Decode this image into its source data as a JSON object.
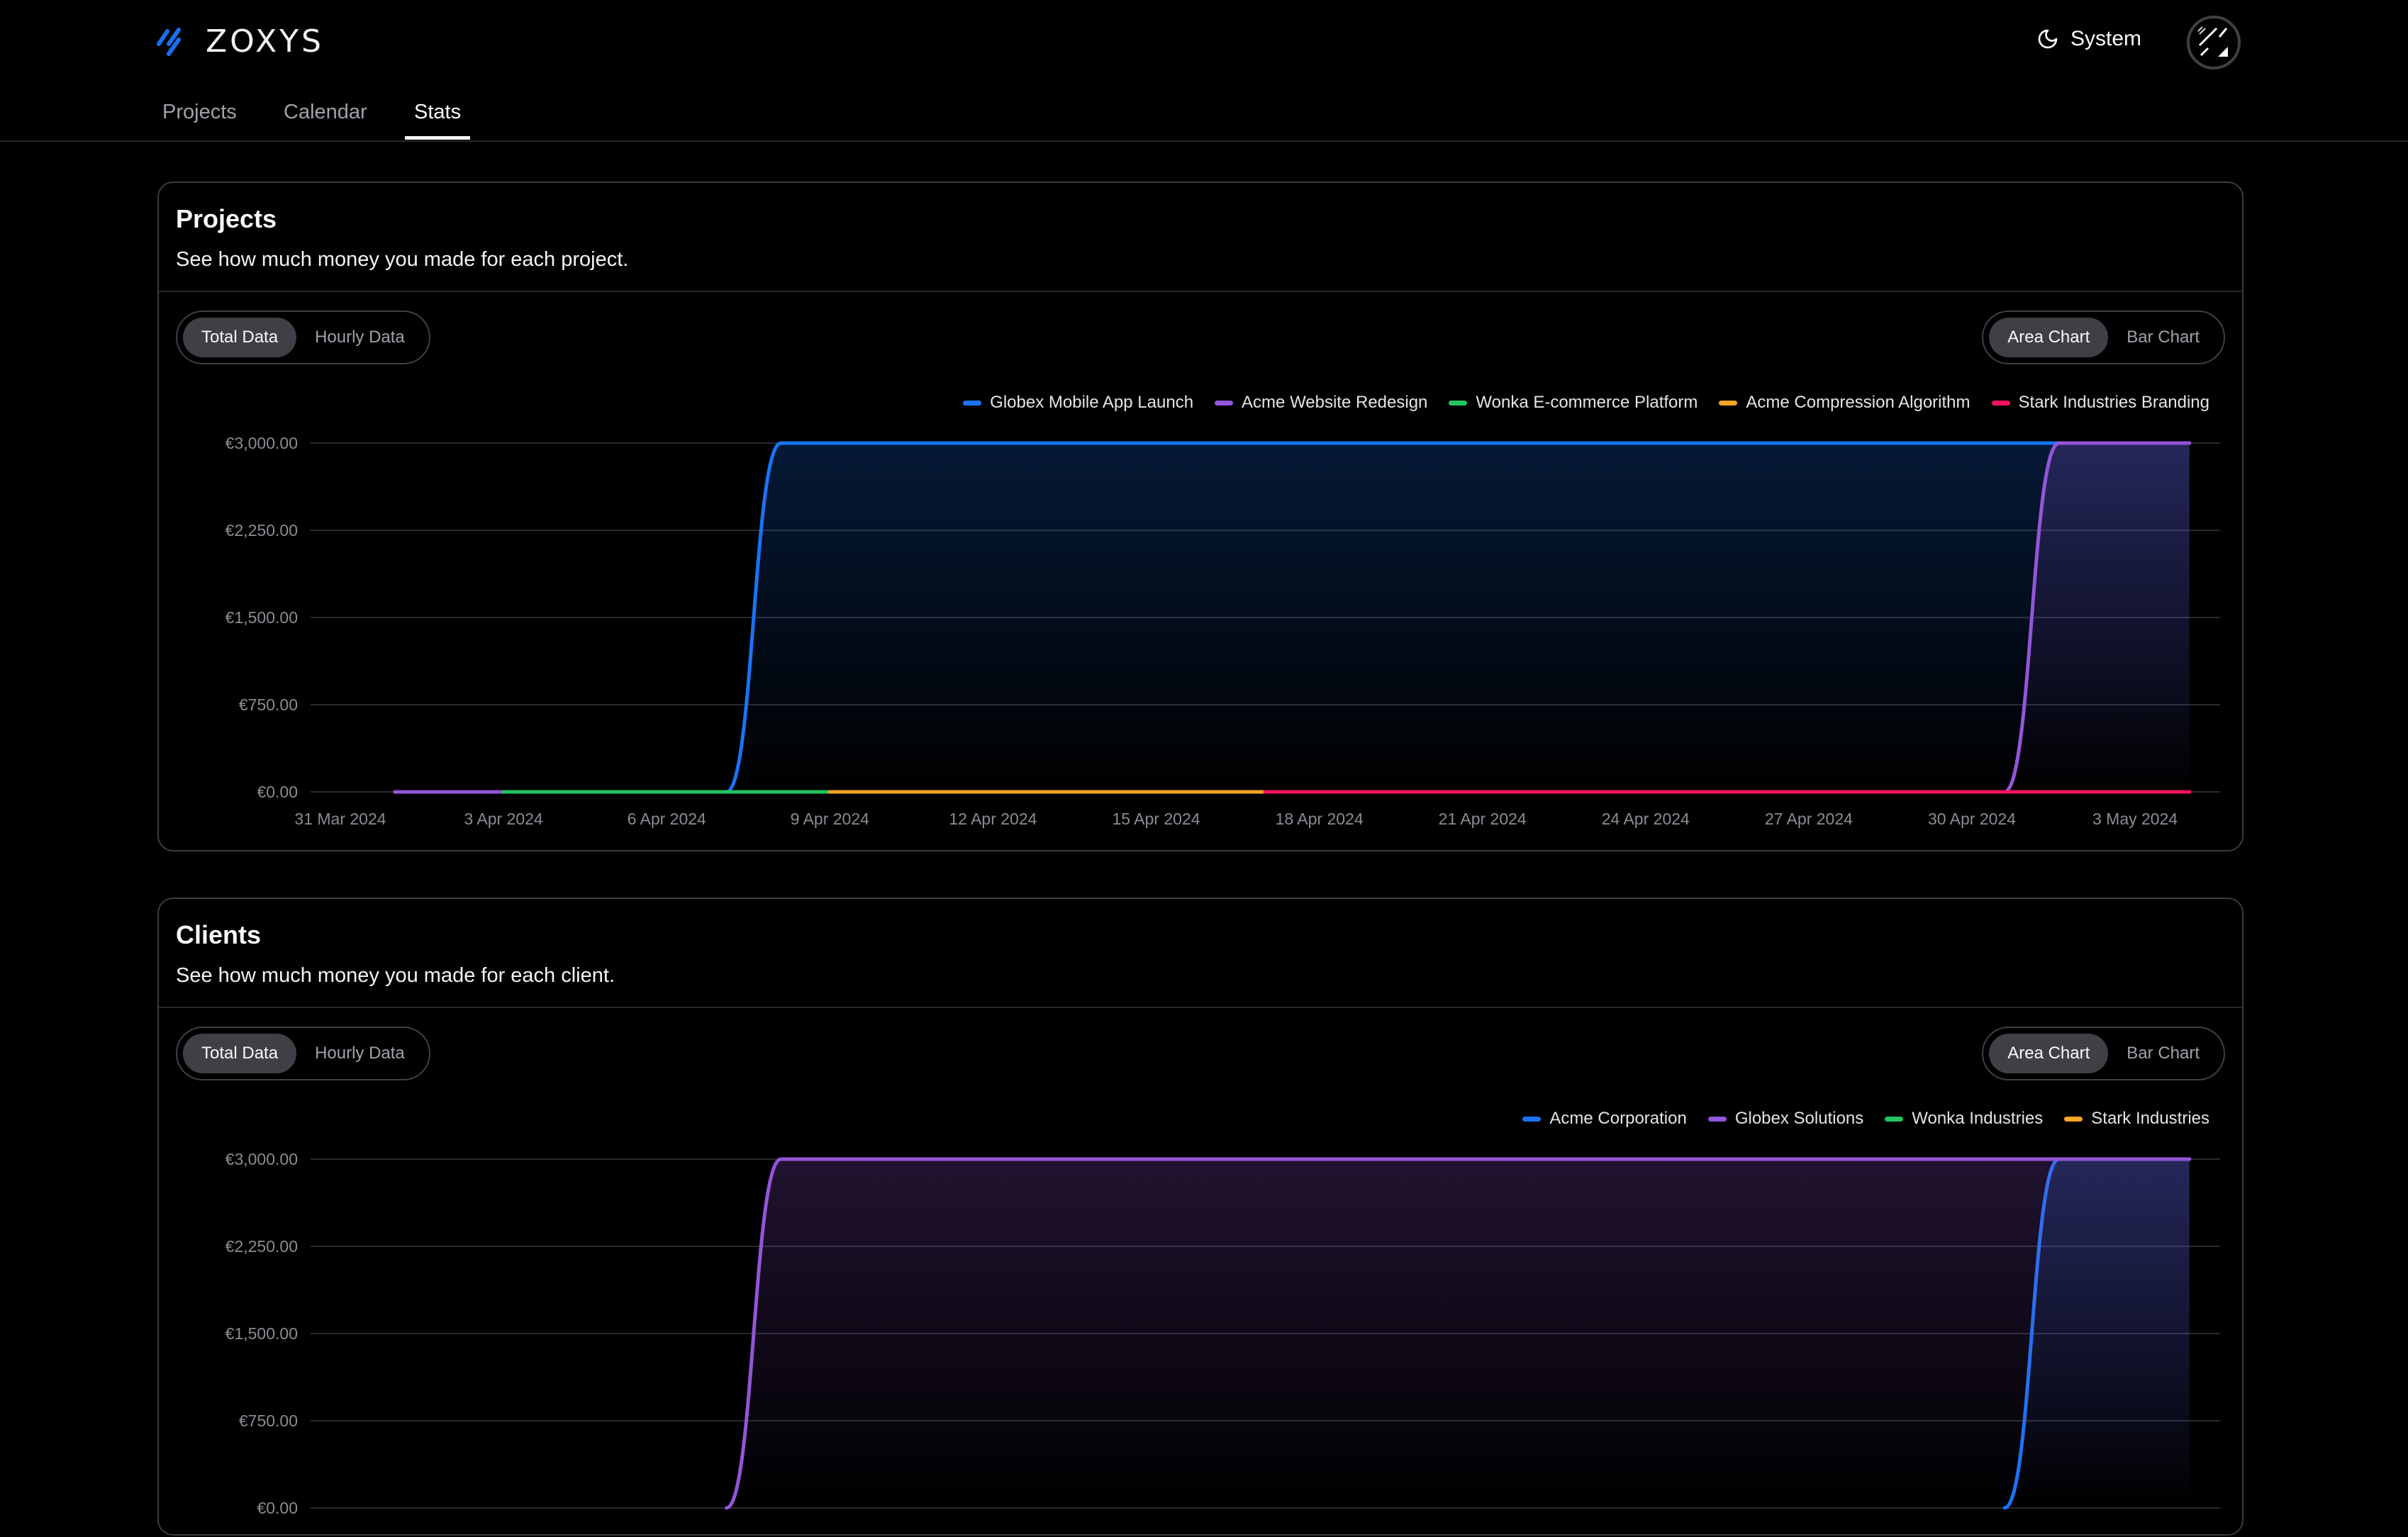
{
  "app": {
    "brand": "ZOXYS",
    "logo_icon": "triple-slash-logo-icon"
  },
  "nav": {
    "tabs": [
      {
        "label": "Projects",
        "active": false
      },
      {
        "label": "Calendar",
        "active": false
      },
      {
        "label": "Stats",
        "active": true
      }
    ]
  },
  "header": {
    "theme_label": "System",
    "theme_icon": "moon-icon",
    "avatar_icon": "avatar-pattern-icon"
  },
  "colors": {
    "blue": "#1a73f5",
    "purple": "#9355d9",
    "green": "#22c55e",
    "orange": "#f5a524",
    "red": "#f31260",
    "grid": "#2a2a2e",
    "tick": "#8b8b94"
  },
  "cards": [
    {
      "title": "Projects",
      "subtitle": "See how much money you made for each project.",
      "data_toggle": [
        {
          "label": "Total Data",
          "active": true
        },
        {
          "label": "Hourly Data",
          "active": false
        }
      ],
      "chart_toggle": [
        {
          "label": "Area Chart",
          "active": true
        },
        {
          "label": "Bar Chart",
          "active": false
        }
      ]
    },
    {
      "title": "Clients",
      "subtitle": "See how much money you made for each client.",
      "data_toggle": [
        {
          "label": "Total Data",
          "active": true
        },
        {
          "label": "Hourly Data",
          "active": false
        }
      ],
      "chart_toggle": [
        {
          "label": "Area Chart",
          "active": true
        },
        {
          "label": "Bar Chart",
          "active": false
        }
      ]
    }
  ],
  "chart_data": [
    {
      "type": "area",
      "title": "Projects",
      "xlabel": "",
      "ylabel": "",
      "x_ticks": [
        "31 Mar 2024",
        "3 Apr 2024",
        "6 Apr 2024",
        "9 Apr 2024",
        "12 Apr 2024",
        "15 Apr 2024",
        "18 Apr 2024",
        "21 Apr 2024",
        "24 Apr 2024",
        "27 Apr 2024",
        "30 Apr 2024",
        "3 May 2024"
      ],
      "y_ticks": [
        "€0.00",
        "€750.00",
        "€1,500.00",
        "€2,250.00",
        "€3,000.00"
      ],
      "ylim": [
        0,
        3000
      ],
      "xlim_days": [
        0,
        34
      ],
      "x_origin": "31 Mar 2024",
      "grid": true,
      "legend_position": "top-right",
      "series": [
        {
          "name": "Globex Mobile App Launch",
          "color": "#1a73f5",
          "points": [
            [
              7.1,
              0
            ],
            [
              8.1,
              3000
            ],
            [
              34.0,
              3000
            ]
          ]
        },
        {
          "name": "Acme Website Redesign",
          "color": "#9355d9",
          "points": [
            [
              1.0,
              0
            ],
            [
              3.0,
              0
            ]
          ],
          "points2": [
            [
              30.6,
              0
            ],
            [
              31.6,
              3000
            ],
            [
              34.0,
              3000
            ]
          ]
        },
        {
          "name": "Wonka E-commerce Platform",
          "color": "#22c55e",
          "points": [
            [
              3.0,
              0
            ],
            [
              9.0,
              0
            ]
          ]
        },
        {
          "name": "Acme Compression Algorithm",
          "color": "#f5a524",
          "points": [
            [
              9.0,
              0
            ],
            [
              17.0,
              0
            ]
          ]
        },
        {
          "name": "Stark Industries Branding",
          "color": "#f31260",
          "points": [
            [
              17.0,
              0
            ],
            [
              34.0,
              0
            ]
          ]
        }
      ]
    },
    {
      "type": "area",
      "title": "Clients",
      "xlabel": "",
      "ylabel": "",
      "y_ticks": [
        "€0.00",
        "€750.00",
        "€1,500.00",
        "€2,250.00",
        "€3,000.00"
      ],
      "ylim": [
        0,
        3000
      ],
      "xlim_days": [
        0,
        34
      ],
      "grid": true,
      "legend_position": "top-right",
      "series": [
        {
          "name": "Acme Corporation",
          "color": "#1a73f5",
          "points": [
            [
              30.6,
              0
            ],
            [
              31.6,
              3000
            ],
            [
              34.0,
              3000
            ]
          ]
        },
        {
          "name": "Globex Solutions",
          "color": "#9355d9",
          "points": [
            [
              7.1,
              0
            ],
            [
              8.1,
              3000
            ],
            [
              34.0,
              3000
            ]
          ]
        },
        {
          "name": "Wonka Industries",
          "color": "#22c55e",
          "points": []
        },
        {
          "name": "Stark Industries",
          "color": "#f5a524",
          "points": []
        }
      ]
    }
  ]
}
